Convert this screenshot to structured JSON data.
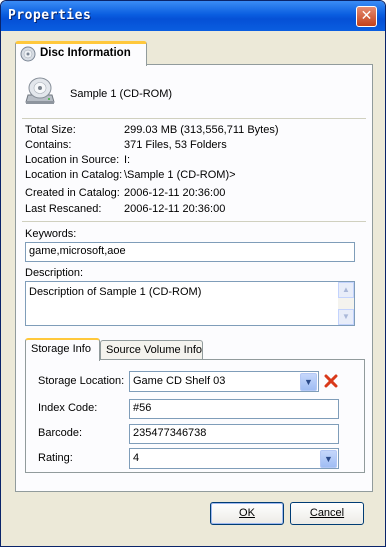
{
  "window": {
    "title": "Properties"
  },
  "tab": {
    "label": "Disc Information"
  },
  "disc": {
    "name": "Sample 1 (CD-ROM)"
  },
  "info": [
    {
      "label": "Total Size:",
      "value": "299.03 MB (313,556,711 Bytes)"
    },
    {
      "label": "Contains:",
      "value": "371 Files, 53 Folders"
    },
    {
      "label": "Location in Source:",
      "value": "I:"
    },
    {
      "label": "Location in Catalog:",
      "value": "\\Sample 1 (CD-ROM)>"
    },
    {
      "label": "Created in Catalog:",
      "value": "2006-12-11 20:36:00"
    },
    {
      "label": "Last Rescaned:",
      "value": "2006-12-11 20:36:00"
    }
  ],
  "keywords": {
    "label": "Keywords:",
    "value": "game,microsoft,aoe"
  },
  "description": {
    "label": "Description:",
    "value": "Description of Sample 1 (CD-ROM)"
  },
  "inner_tabs": [
    "Storage Info",
    "Source Volume Info"
  ],
  "storage": {
    "location_label": "Storage Location:",
    "location_value": "Game CD Shelf 03",
    "index_label": "Index Code:",
    "index_value": "#56",
    "barcode_label": "Barcode:",
    "barcode_value": "235477346738",
    "rating_label": "Rating:",
    "rating_value": "4"
  },
  "buttons": {
    "ok": "OK",
    "cancel": "Cancel"
  },
  "icons": {
    "close": "close-icon",
    "tab": "disc-icon",
    "disc": "cd-drive-icon",
    "delete": "delete-x-icon",
    "dropdown": "chevron-down-icon"
  },
  "colors": {
    "titlebar": "#0a5ee0",
    "dialog_bg": "#ece9d8",
    "panel_bg": "#fcfcfe",
    "tab_highlight": "#ffc83c",
    "delete_icon": "#d9391a"
  }
}
